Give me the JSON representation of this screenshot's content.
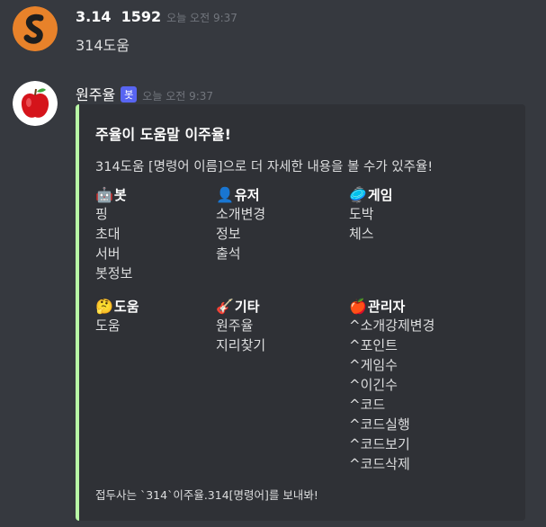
{
  "messages": [
    {
      "author": "3.14  1592",
      "timestamp": "오늘 오전 9:37",
      "content": "314도움",
      "avatar_icon": "s-logo-icon"
    },
    {
      "author": "원주율",
      "bot_badge": "봇",
      "timestamp": "오늘 오전 9:37",
      "avatar_icon": "apple-icon",
      "embed": {
        "accent_color": "#b9f8a6",
        "title": "주율이 도움말 이주율!",
        "description": "314도움 [명령어 이름]으로 더 자세한 내용을 볼 수가 있주율!",
        "fields": [
          {
            "emoji": "🤖",
            "name": "봇",
            "values": [
              "핑",
              "초대",
              "서버",
              "봇정보"
            ]
          },
          {
            "emoji": "👤",
            "name": "유저",
            "values": [
              "소개변경",
              "정보",
              "출석"
            ]
          },
          {
            "emoji": "🥏",
            "name": "게임",
            "values": [
              "도박",
              "체스"
            ]
          },
          {
            "emoji": "🤔",
            "name": "도움",
            "values": [
              "도움"
            ]
          },
          {
            "emoji": "🎸",
            "name": "기타",
            "values": [
              "원주율",
              "지리찾기"
            ]
          },
          {
            "emoji": "🍎",
            "name": "관리자",
            "values": [
              "^소개강제변경",
              "^포인트",
              "^게임수",
              "^이긴수",
              "^코드",
              "^코드실행",
              "^코드보기",
              "^코드삭제"
            ]
          }
        ],
        "footer": "접두사는 `314`이주율.314[명령어]를 보내봐!"
      }
    }
  ],
  "colors": {
    "background": "#36393f",
    "embed_bg": "#2f3136",
    "bot_badge": "#5865f2"
  }
}
